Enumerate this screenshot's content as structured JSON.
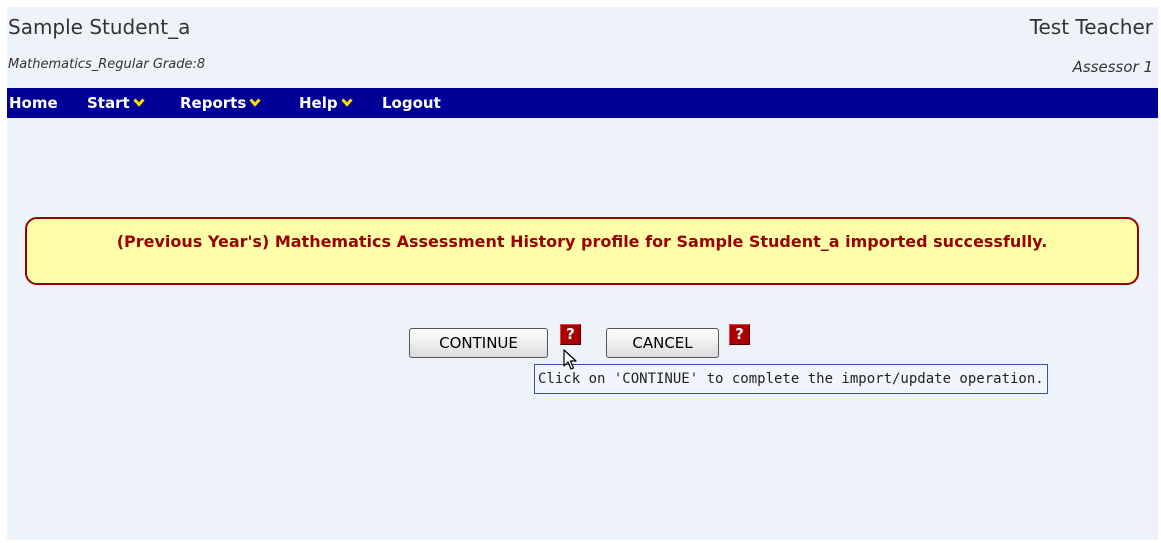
{
  "header": {
    "student_name": "Sample Student_a",
    "teacher_name": "Test Teacher",
    "subject_grade": "Mathematics_Regular Grade:8",
    "assessor": "Assessor 1"
  },
  "nav": {
    "home": "Home",
    "start": "Start",
    "reports": "Reports",
    "help": "Help",
    "logout": "Logout",
    "chevron_icon": "chevron-down-icon"
  },
  "alert": {
    "message": "(Previous Year's) Mathematics Assessment History profile for Sample Student_a imported successfully."
  },
  "actions": {
    "continue_label": "CONTINUE",
    "cancel_label": "CANCEL",
    "help_icon_text": "?",
    "tooltip": "Click on 'CONTINUE' to complete the import/update operation."
  },
  "colors": {
    "page_background": "#eef2f9",
    "navbar": "#000099",
    "alert_background": "#ffffaa",
    "alert_border": "#990000",
    "help_icon": "#aa0000"
  }
}
